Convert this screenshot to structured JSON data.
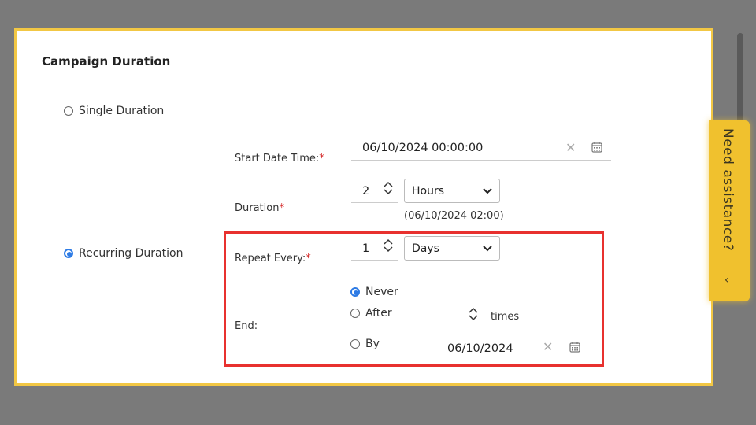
{
  "section": {
    "title": "Campaign Duration"
  },
  "modes": {
    "single": {
      "label": "Single Duration",
      "checked": false
    },
    "recurring": {
      "label": "Recurring Duration",
      "checked": true
    }
  },
  "start": {
    "label": "Start Date Time:",
    "required_mark": "*",
    "value": "06/10/2024 00:00:00"
  },
  "duration": {
    "label": "Duration",
    "required_mark": "*",
    "value": "2",
    "unit": "Hours",
    "computed": "(06/10/2024 02:00)"
  },
  "repeat": {
    "label": "Repeat Every:",
    "required_mark": "*",
    "value": "1",
    "unit": "Days"
  },
  "end": {
    "label": "End:",
    "options": [
      {
        "label": "Never",
        "checked": true
      },
      {
        "label": "After",
        "checked": false
      },
      {
        "label": "By",
        "checked": false
      }
    ],
    "times_label": "times",
    "by_date": "06/10/2024"
  },
  "assist": {
    "label": "Need assistance?",
    "chevron": "‹"
  },
  "colors": {
    "accent": "#2d7be5",
    "highlight_border": "#e8312f",
    "panel_border": "#f2c744",
    "assist_bg": "#f0c12e"
  },
  "icons": [
    "clear-icon",
    "calendar-icon",
    "stepper-up-icon",
    "stepper-down-icon",
    "chevron-down-icon"
  ]
}
